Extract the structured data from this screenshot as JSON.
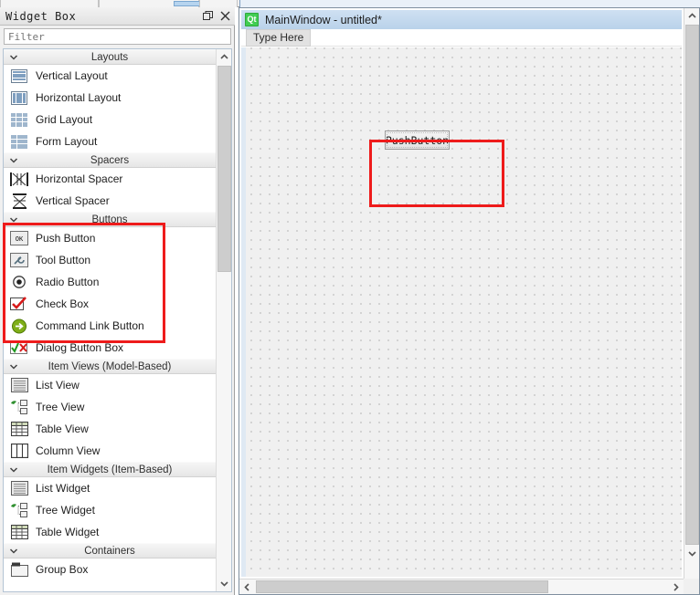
{
  "widget_box": {
    "title": "Widget Box",
    "float_button_name": "float-dock-button",
    "close_button_name": "close-button",
    "filter_placeholder": "Filter",
    "filter_value": "",
    "categories": [
      {
        "name": "Layouts",
        "expanded": true,
        "items": [
          {
            "label": "Vertical Layout",
            "icon": "vertical-layout-icon"
          },
          {
            "label": "Horizontal Layout",
            "icon": "horizontal-layout-icon"
          },
          {
            "label": "Grid Layout",
            "icon": "grid-layout-icon"
          },
          {
            "label": "Form Layout",
            "icon": "form-layout-icon"
          }
        ]
      },
      {
        "name": "Spacers",
        "expanded": true,
        "items": [
          {
            "label": "Horizontal Spacer",
            "icon": "horizontal-spacer-icon"
          },
          {
            "label": "Vertical Spacer",
            "icon": "vertical-spacer-icon"
          }
        ]
      },
      {
        "name": "Buttons",
        "expanded": true,
        "items": [
          {
            "label": "Push Button",
            "icon": "push-button-icon"
          },
          {
            "label": "Tool Button",
            "icon": "tool-button-icon"
          },
          {
            "label": "Radio Button",
            "icon": "radio-button-icon"
          },
          {
            "label": "Check Box",
            "icon": "check-box-icon"
          },
          {
            "label": "Command Link Button",
            "icon": "command-link-button-icon"
          },
          {
            "label": "Dialog Button Box",
            "icon": "dialog-button-box-icon"
          }
        ]
      },
      {
        "name": "Item Views (Model-Based)",
        "expanded": true,
        "items": [
          {
            "label": "List View",
            "icon": "list-view-icon"
          },
          {
            "label": "Tree View",
            "icon": "tree-view-icon"
          },
          {
            "label": "Table View",
            "icon": "table-view-icon"
          },
          {
            "label": "Column View",
            "icon": "column-view-icon"
          }
        ]
      },
      {
        "name": "Item Widgets (Item-Based)",
        "expanded": true,
        "items": [
          {
            "label": "List Widget",
            "icon": "list-widget-icon"
          },
          {
            "label": "Tree Widget",
            "icon": "tree-widget-icon"
          },
          {
            "label": "Table Widget",
            "icon": "table-widget-icon"
          }
        ]
      },
      {
        "name": "Containers",
        "expanded": true,
        "items": [
          {
            "label": "Group Box",
            "icon": "group-box-icon"
          }
        ]
      }
    ]
  },
  "form_editor": {
    "window_icon_text": "Qt",
    "window_title": "MainWindow - untitled*",
    "menubar_placeholder": "Type Here",
    "widgets": [
      {
        "type": "push-button",
        "text": "PushButton"
      }
    ]
  },
  "annotations": {
    "accent_color": "#ee1b1b",
    "boxes": [
      {
        "name": "buttons-category-highlight"
      },
      {
        "name": "pushbutton-drop-highlight"
      }
    ]
  }
}
